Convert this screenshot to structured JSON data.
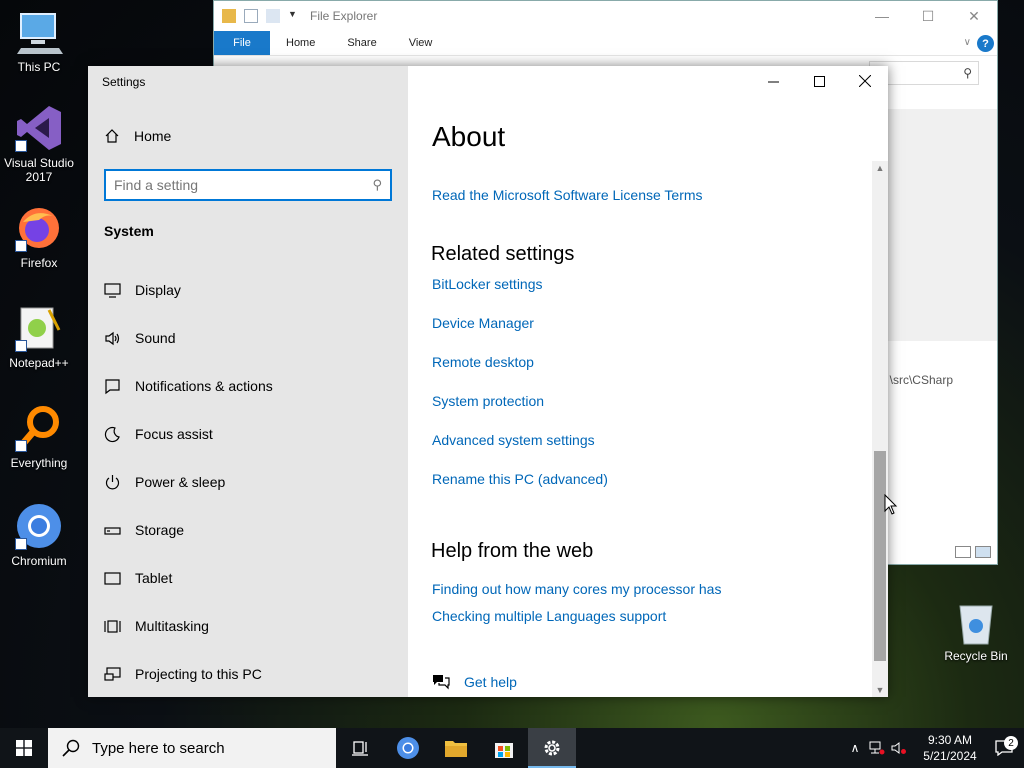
{
  "desktop": {
    "icons": [
      {
        "label": "This PC"
      },
      {
        "label": "Visual Studio 2017"
      },
      {
        "label": "Firefox"
      },
      {
        "label": "Notepad++"
      },
      {
        "label": "Everything"
      },
      {
        "label": "Chromium"
      }
    ],
    "recycle_bin": "Recycle Bin"
  },
  "file_explorer": {
    "title": "File Explorer",
    "tabs": [
      "File",
      "Home",
      "Share",
      "View"
    ],
    "help": "?",
    "path_fragment": "\\src\\CSharp"
  },
  "settings": {
    "window_title": "Settings",
    "home_label": "Home",
    "search_placeholder": "Find a setting",
    "section_title": "System",
    "nav_items": [
      {
        "label": "Display",
        "icon": "display-icon"
      },
      {
        "label": "Sound",
        "icon": "sound-icon"
      },
      {
        "label": "Notifications & actions",
        "icon": "notifications-icon"
      },
      {
        "label": "Focus assist",
        "icon": "focus-assist-icon"
      },
      {
        "label": "Power & sleep",
        "icon": "power-icon"
      },
      {
        "label": "Storage",
        "icon": "storage-icon"
      },
      {
        "label": "Tablet",
        "icon": "tablet-icon"
      },
      {
        "label": "Multitasking",
        "icon": "multitasking-icon"
      },
      {
        "label": "Projecting to this PC",
        "icon": "projecting-icon"
      }
    ],
    "page_title": "About",
    "license_link": "Read the Microsoft Software License Terms",
    "related_title": "Related settings",
    "related_links": [
      "BitLocker settings",
      "Device Manager",
      "Remote desktop",
      "System protection",
      "Advanced system settings",
      "Rename this PC (advanced)"
    ],
    "help_title": "Help from the web",
    "help_links": [
      "Finding out how many cores my processor has",
      "Checking multiple Languages support"
    ],
    "get_help": "Get help",
    "accent": "#0078d7",
    "link_color": "#0067b8"
  },
  "taskbar": {
    "search_placeholder": "Type here to search",
    "time": "9:30 AM",
    "date": "5/21/2024",
    "notification_count": "2"
  }
}
